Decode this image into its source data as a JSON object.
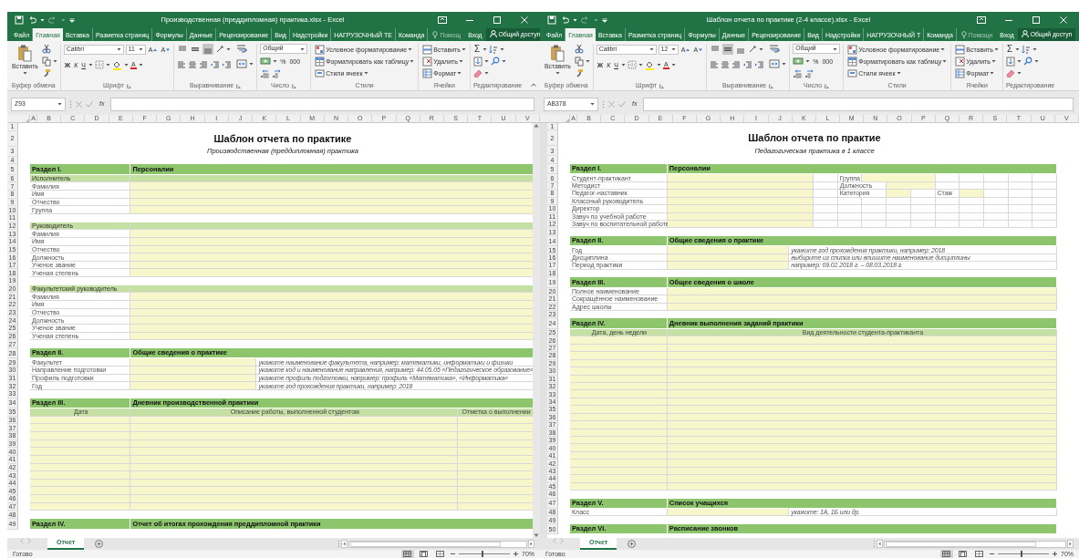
{
  "windows": [
    {
      "title": "Производственная (преддипломная) практика.xlsx - Excel",
      "tabs": [
        {
          "label": "Файл",
          "selected": false
        },
        {
          "label": "Главная",
          "selected": true
        },
        {
          "label": "Вставка",
          "selected": false
        },
        {
          "label": "Разметка страниц",
          "selected": false
        },
        {
          "label": "Формулы",
          "selected": false
        },
        {
          "label": "Данные",
          "selected": false
        },
        {
          "label": "Рецензирование",
          "selected": false
        },
        {
          "label": "Вид",
          "selected": false
        },
        {
          "label": "Надстройки",
          "selected": false
        },
        {
          "label": "НАГРУЗОЧНЫЙ ТЕ",
          "selected": false
        },
        {
          "label": "Команда",
          "selected": false
        }
      ],
      "tell_me": "Помощ",
      "sign_in": "Вход",
      "share": "Общий доступ",
      "ribbon": {
        "paste": "Вставить",
        "font_name": "Calibri",
        "font_size": "11",
        "size_buttons": [
          "A",
          "A"
        ],
        "style_buttons": [
          "Ж",
          "К",
          "Ч"
        ],
        "font_color": "A",
        "valign": [
          {
            "selected": false
          },
          {
            "selected": false
          },
          {
            "selected": true
          }
        ],
        "number_format": "Общий",
        "number_buttons": [
          "%",
          "000"
        ],
        "styles": [
          "Условное форматирование",
          "Форматировать как таблицу",
          "Стили ячеек"
        ],
        "cells": [
          "Вставить",
          "Удалить",
          "Формат"
        ],
        "sum": "Σ",
        "groups": [
          "Буфер обмена",
          "Шрифт",
          "Выравнивание",
          "Число",
          "Стили",
          "Ячейки",
          "Редактирование"
        ]
      },
      "name_box": "Z93",
      "fx": "fx",
      "columns": [
        "A",
        "B",
        "C",
        "D",
        "E",
        "F",
        "G",
        "H",
        "I",
        "J",
        "K",
        "L",
        "M",
        "N",
        "O",
        "P",
        "Q",
        "R",
        "S",
        "T",
        "U",
        "V"
      ],
      "rows": [
        {
          "num": "1",
          "kind": "blank"
        },
        {
          "num": "2",
          "kind": "title",
          "text": "Шаблон отчета по практике"
        },
        {
          "num": "3",
          "kind": "subtitle",
          "text": "Производственная (преддипломная) практика"
        },
        {
          "num": "4",
          "kind": "blank"
        },
        {
          "num": "5",
          "kind": "section",
          "cells": [
            "Раздел I.",
            "Персоналии"
          ]
        },
        {
          "num": "6",
          "kind": "group",
          "text": "Исполнитель"
        },
        {
          "num": "7",
          "kind": "field",
          "text": "Фамилия"
        },
        {
          "num": "8",
          "kind": "field",
          "text": "Имя"
        },
        {
          "num": "9",
          "kind": "field",
          "text": "Отчество"
        },
        {
          "num": "10",
          "kind": "field",
          "text": "Группа"
        },
        {
          "num": "11",
          "kind": "blank"
        },
        {
          "num": "12",
          "kind": "group",
          "text": "Руководитель"
        },
        {
          "num": "13",
          "kind": "field",
          "text": "Фамилия"
        },
        {
          "num": "14",
          "kind": "field",
          "text": "Имя"
        },
        {
          "num": "15",
          "kind": "field",
          "text": "Отчество"
        },
        {
          "num": "16",
          "kind": "field",
          "text": "Должность"
        },
        {
          "num": "17",
          "kind": "field",
          "text": "Ученое звание"
        },
        {
          "num": "18",
          "kind": "field",
          "text": "Ученая степень"
        },
        {
          "num": "19",
          "kind": "blank"
        },
        {
          "num": "20",
          "kind": "group",
          "text": "Факультетский руководитель"
        },
        {
          "num": "21",
          "kind": "field",
          "text": "Фамилия"
        },
        {
          "num": "22",
          "kind": "field",
          "text": "Имя"
        },
        {
          "num": "23",
          "kind": "field",
          "text": "Отчество"
        },
        {
          "num": "24",
          "kind": "field",
          "text": "Должность"
        },
        {
          "num": "25",
          "kind": "field",
          "text": "Ученое звание"
        },
        {
          "num": "26",
          "kind": "field",
          "text": "Ученая степень"
        },
        {
          "num": "27",
          "kind": "blank"
        },
        {
          "num": "28",
          "kind": "section",
          "cells": [
            "Раздел II.",
            "Общие сведения о практике"
          ]
        },
        {
          "num": "29",
          "kind": "hint",
          "text": "Факультет",
          "hint": "укажите наименование факультета, например: математики, информатики и физики"
        },
        {
          "num": "30",
          "kind": "hint",
          "text": "Направление подготовки",
          "hint": "укажите код и наименование направления, например: 44.05.05 «Педагогическое образование»"
        },
        {
          "num": "31",
          "kind": "hint",
          "text": "Профиль подготовки",
          "hint": "укажите профиль подготовки, например: профиль «Математика», «Информатика»"
        },
        {
          "num": "32",
          "kind": "hint",
          "text": "Год",
          "hint": "укажите год прохождения практики, например: 2018"
        },
        {
          "num": "33",
          "kind": "blank"
        },
        {
          "num": "34",
          "kind": "section",
          "cells": [
            "Раздел III.",
            "Дневник производственной практики"
          ]
        },
        {
          "num": "35",
          "kind": "diary_head",
          "cells": [
            "Дата",
            "Описание работы, выполненной студентом",
            "Отметка о выполнении"
          ]
        },
        {
          "num": "36",
          "kind": "diary3"
        },
        {
          "num": "37",
          "kind": "diary3"
        },
        {
          "num": "38",
          "kind": "diary3"
        },
        {
          "num": "39",
          "kind": "diary3"
        },
        {
          "num": "40",
          "kind": "diary3"
        },
        {
          "num": "41",
          "kind": "diary3"
        },
        {
          "num": "42",
          "kind": "diary3"
        },
        {
          "num": "43",
          "kind": "diary3"
        },
        {
          "num": "44",
          "kind": "diary3"
        },
        {
          "num": "45",
          "kind": "diary3"
        },
        {
          "num": "46",
          "kind": "diary3"
        },
        {
          "num": "47",
          "kind": "diary3"
        },
        {
          "num": "48",
          "kind": "blank"
        },
        {
          "num": "49",
          "kind": "section",
          "cells": [
            "Раздел IV.",
            "Отчет об итогах прохождения преддипломной практики"
          ]
        }
      ],
      "sheet_tab": "Отчет",
      "status": "Готово",
      "views": [
        {
          "selected": true
        },
        {
          "selected": false
        },
        {
          "selected": false
        }
      ],
      "zoom_slider": {
        "level": 0.45
      },
      "zoom": "70%"
    },
    {
      "title": "Шаблон отчета по практике (2-4 классе).xlsx - Excel",
      "tabs": [
        {
          "label": "Файл",
          "selected": false
        },
        {
          "label": "Главная",
          "selected": true
        },
        {
          "label": "Вставка",
          "selected": false
        },
        {
          "label": "Разметка страниц",
          "selected": false
        },
        {
          "label": "Формулы",
          "selected": false
        },
        {
          "label": "Данные",
          "selected": false
        },
        {
          "label": "Рецензирование",
          "selected": false
        },
        {
          "label": "Вид",
          "selected": false
        },
        {
          "label": "Надстройки",
          "selected": false
        },
        {
          "label": "НАГРУЗОЧНЫЙ Т",
          "selected": false
        },
        {
          "label": "Команда",
          "selected": false
        }
      ],
      "tell_me": "Помощн",
      "sign_in": "Вход",
      "share": "Общий доступ",
      "ribbon": {
        "paste": "Вставить",
        "font_name": "Calibri",
        "font_size": "12",
        "size_buttons": [
          "A",
          "A"
        ],
        "style_buttons": [
          "Ж",
          "К",
          "Ч"
        ],
        "font_color": "A",
        "valign": [
          {
            "selected": false
          },
          {
            "selected": true
          },
          {
            "selected": false
          }
        ],
        "number_format": "Общий",
        "number_buttons": [
          "%",
          "000"
        ],
        "styles": [
          "Условное форматирование",
          "Форматировать как таблицу",
          "Стили ячеек"
        ],
        "cells": [
          "Вставить",
          "Удалить",
          "Формат"
        ],
        "sum": "Σ",
        "groups": [
          "Буфер обмена",
          "Шрифт",
          "Выравнивание",
          "Число",
          "Стили",
          "Ячейки",
          "Редактирование"
        ]
      },
      "name_box": "AB378",
      "fx": "fx",
      "columns": [
        "A",
        "B",
        "C",
        "D",
        "E",
        "F",
        "G",
        "H",
        "I",
        "J",
        "K",
        "L",
        "M",
        "N",
        "O",
        "P",
        "Q",
        "R",
        "S",
        "T",
        "U",
        "V"
      ],
      "rows": [
        {
          "num": "1",
          "kind": "blank"
        },
        {
          "num": "2",
          "kind": "title",
          "text": "Шаблон отчета по практие"
        },
        {
          "num": "3",
          "kind": "subtitle",
          "text": "Педагогическая практика в 1 классе"
        },
        {
          "num": "4",
          "kind": "blank"
        },
        {
          "num": "5",
          "kind": "section",
          "cells": [
            "Раздел I.",
            "Персоналии"
          ]
        },
        {
          "num": "6",
          "kind": "person_a",
          "text": "Студент-практикант",
          "extra": [
            "Группа"
          ]
        },
        {
          "num": "7",
          "kind": "person_b",
          "text": "Методист",
          "extra": [
            "Должность"
          ]
        },
        {
          "num": "8",
          "kind": "person_c",
          "text": "Педагог-наставник",
          "extra": [
            "Категория",
            "Стаж"
          ]
        },
        {
          "num": "9",
          "kind": "person",
          "text": "Классный руководитель"
        },
        {
          "num": "10",
          "kind": "person",
          "text": "Директор"
        },
        {
          "num": "11",
          "kind": "person",
          "text": "Завуч по учебной работе"
        },
        {
          "num": "12",
          "kind": "person",
          "text": "Завуч по воспитательной работе"
        },
        {
          "num": "13",
          "kind": "blank"
        },
        {
          "num": "14",
          "kind": "section",
          "cells": [
            "Раздел II.",
            "Общие сведения о практике"
          ]
        },
        {
          "num": "15",
          "kind": "hint",
          "text": "Год",
          "hint": "укажите год прохождения практики, например: 2018"
        },
        {
          "num": "16",
          "kind": "hint",
          "text": "Дисциплина",
          "hint": "выбирите из списка или впишите наименование дисциплины"
        },
        {
          "num": "17",
          "kind": "hint",
          "text": "Период практики",
          "hint": "например: 09.02.2018 г. – 08.03.2018 г."
        },
        {
          "num": "18",
          "kind": "blank"
        },
        {
          "num": "19",
          "kind": "section",
          "cells": [
            "Раздел III.",
            "Общее сведения о школе"
          ]
        },
        {
          "num": "20",
          "kind": "field",
          "text": "Полное наименование"
        },
        {
          "num": "21",
          "kind": "field",
          "text": "Сокращённое наименование"
        },
        {
          "num": "22",
          "kind": "field",
          "text": "Адрес школы"
        },
        {
          "num": "23",
          "kind": "blank"
        },
        {
          "num": "24",
          "kind": "section",
          "cells": [
            "Раздел IV.",
            "Дневник выполнения заданий практики"
          ]
        },
        {
          "num": "25",
          "kind": "diary_head",
          "cells": [
            "Дата, день недели",
            "Вид деятельности студента-практиканта"
          ]
        },
        {
          "num": "26",
          "kind": "diary2"
        },
        {
          "num": "27",
          "kind": "diary2"
        },
        {
          "num": "28",
          "kind": "diary2"
        },
        {
          "num": "29",
          "kind": "diary2"
        },
        {
          "num": "30",
          "kind": "diary2"
        },
        {
          "num": "31",
          "kind": "diary2"
        },
        {
          "num": "32",
          "kind": "diary2"
        },
        {
          "num": "33",
          "kind": "diary2"
        },
        {
          "num": "34",
          "kind": "diary2"
        },
        {
          "num": "35",
          "kind": "diary2"
        },
        {
          "num": "36",
          "kind": "diary2"
        },
        {
          "num": "37",
          "kind": "diary2"
        },
        {
          "num": "38",
          "kind": "diary2"
        },
        {
          "num": "39",
          "kind": "diary2"
        },
        {
          "num": "40",
          "kind": "diary2"
        },
        {
          "num": "41",
          "kind": "diary2"
        },
        {
          "num": "42",
          "kind": "diary2"
        },
        {
          "num": "43",
          "kind": "diary2"
        },
        {
          "num": "44",
          "kind": "diary2"
        },
        {
          "num": "45",
          "kind": "diary2"
        },
        {
          "num": "46",
          "kind": "blank"
        },
        {
          "num": "47",
          "kind": "section",
          "cells": [
            "Раздел V.",
            "Список учащихся"
          ]
        },
        {
          "num": "48",
          "kind": "hint",
          "text": "Класс",
          "hint": "укажите: 1А, 1Б или др."
        },
        {
          "num": "49",
          "kind": "blank"
        },
        {
          "num": "50",
          "kind": "section",
          "cells": [
            "Раздел VI.",
            "Расписание звонков"
          ]
        }
      ],
      "sheet_tab": "Отчет",
      "status": "Готово",
      "views": [
        {
          "selected": true
        },
        {
          "selected": false
        },
        {
          "selected": false
        }
      ],
      "zoom_slider": {
        "level": 0.45
      },
      "zoom": "70%"
    }
  ]
}
